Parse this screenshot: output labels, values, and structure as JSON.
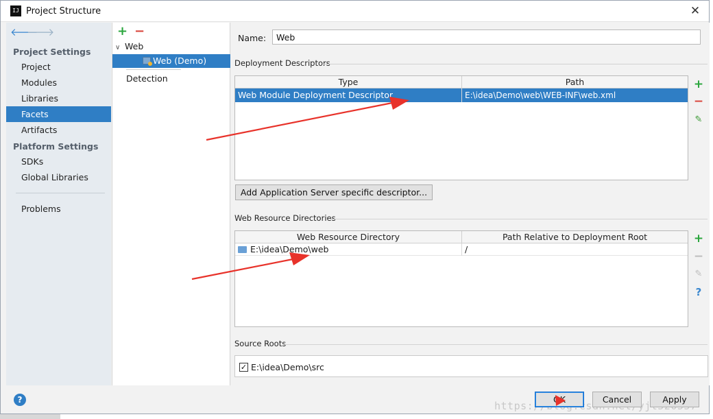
{
  "window": {
    "title": "Project Structure",
    "app_icon": "IJ",
    "close_glyph": "✕"
  },
  "sidebar": {
    "section_project": "Project Settings",
    "items_project": [
      {
        "label": "Project"
      },
      {
        "label": "Modules"
      },
      {
        "label": "Libraries"
      },
      {
        "label": "Facets",
        "selected": true
      },
      {
        "label": "Artifacts"
      }
    ],
    "section_platform": "Platform Settings",
    "items_platform": [
      {
        "label": "SDKs"
      },
      {
        "label": "Global Libraries"
      }
    ],
    "problems": "Problems"
  },
  "facets": {
    "add_glyph": "+",
    "remove_glyph": "−",
    "tree": [
      {
        "label": "Web",
        "expanded": true
      },
      {
        "label": "Web (Demo)",
        "selected": true
      }
    ],
    "detection": "Detection"
  },
  "content": {
    "name_label": "Name:",
    "name_value": "Web",
    "deployment": {
      "title": "Deployment Descriptors",
      "columns": [
        "Type",
        "Path"
      ],
      "rows": [
        {
          "type": "Web Module Deployment Descriptor",
          "path": "E:\\idea\\Demo\\web\\WEB-INF\\web.xml",
          "selected": true
        }
      ],
      "add_server_button": "Add Application Server specific descriptor..."
    },
    "resources": {
      "title": "Web Resource Directories",
      "columns": [
        "Web Resource Directory",
        "Path Relative to Deployment Root"
      ],
      "rows": [
        {
          "dir": "E:\\idea\\Demo\\web",
          "relative": "/"
        }
      ]
    },
    "source_roots": {
      "title": "Source Roots",
      "items": [
        {
          "label": "E:\\idea\\Demo\\src",
          "checked": true,
          "check_glyph": "✓"
        }
      ]
    }
  },
  "footer": {
    "ok": "OK",
    "cancel": "Cancel",
    "apply": "Apply",
    "help_glyph": "?",
    "watermark": "https://blog.csdn.net/yjt520557"
  },
  "colors": {
    "selection": "#2f7ec5",
    "add": "#2aa63d",
    "remove": "#d9433a",
    "annotation": "#e8322a"
  },
  "icons": {
    "back": "arrow-left-icon",
    "forward": "arrow-right-icon",
    "add": "plus-icon",
    "remove": "minus-icon",
    "edit": "pencil-icon",
    "help": "question-icon"
  }
}
